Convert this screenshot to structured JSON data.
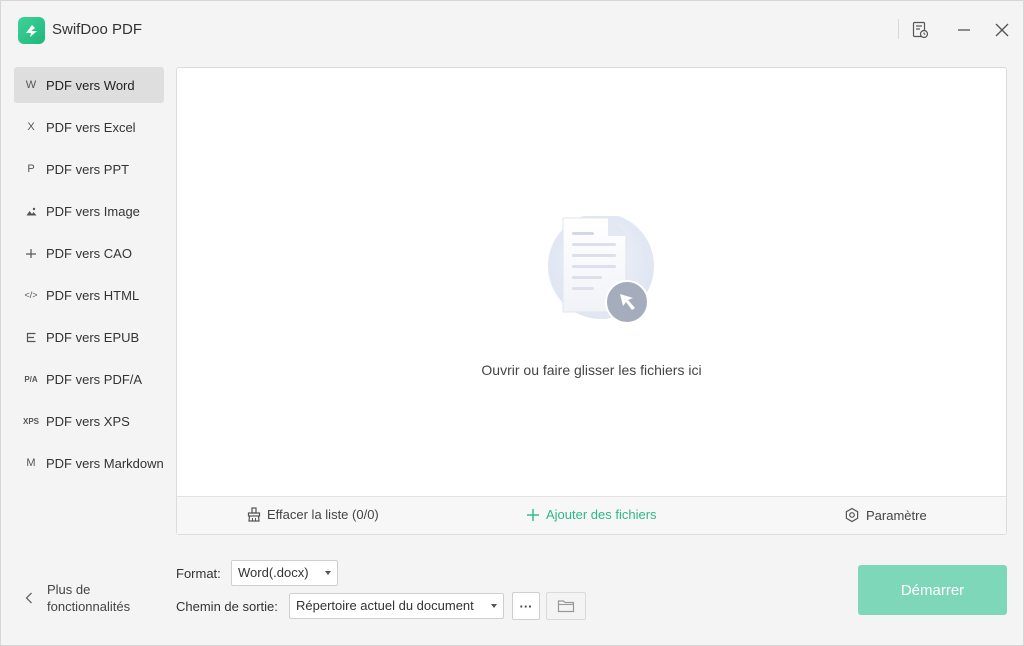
{
  "app": {
    "title": "SwifDoo PDF"
  },
  "titlebar": {
    "icons": [
      "history-icon",
      "minimize-icon",
      "close-icon"
    ]
  },
  "sidebar": {
    "items": [
      {
        "icon_text": "W",
        "icon": "word-icon",
        "label": "PDF vers Word",
        "active": true
      },
      {
        "icon_text": "X",
        "icon": "excel-icon",
        "label": "PDF vers Excel"
      },
      {
        "icon_text": "P",
        "icon": "ppt-icon",
        "label": "PDF vers PPT"
      },
      {
        "icon_text": "",
        "icon": "image-icon",
        "label": "PDF vers Image"
      },
      {
        "icon_text": "",
        "icon": "cad-icon",
        "label": "PDF vers CAO"
      },
      {
        "icon_text": "</>",
        "icon": "html-icon",
        "label": "PDF vers HTML"
      },
      {
        "icon_text": "",
        "icon": "epub-icon",
        "label": "PDF vers EPUB"
      },
      {
        "icon_text": "P/A",
        "icon": "pdfa-icon",
        "label": "PDF vers PDF/A"
      },
      {
        "icon_text": "XPS",
        "icon": "xps-icon",
        "label": "PDF vers XPS"
      },
      {
        "icon_text": "M",
        "icon": "markdown-icon",
        "label": "PDF vers Markdown"
      }
    ],
    "more": {
      "line1": "Plus de",
      "line2": "fonctionnalités"
    }
  },
  "main": {
    "drop_text": "Ouvrir ou faire glisser les fichiers ici",
    "footer": {
      "clear_label": "Effacer la liste (0/0)",
      "add_label": "Ajouter des fichiers",
      "settings_label": "Paramètre"
    }
  },
  "options": {
    "format_label": "Format:",
    "format_value": "Word(.docx)",
    "output_label": "Chemin de sortie:",
    "output_value": "Répertoire actuel du document",
    "more_button": "···"
  },
  "start_button": "Démarrer",
  "colors": {
    "accent": "#2db888",
    "start_button": "#7fd7b9"
  }
}
